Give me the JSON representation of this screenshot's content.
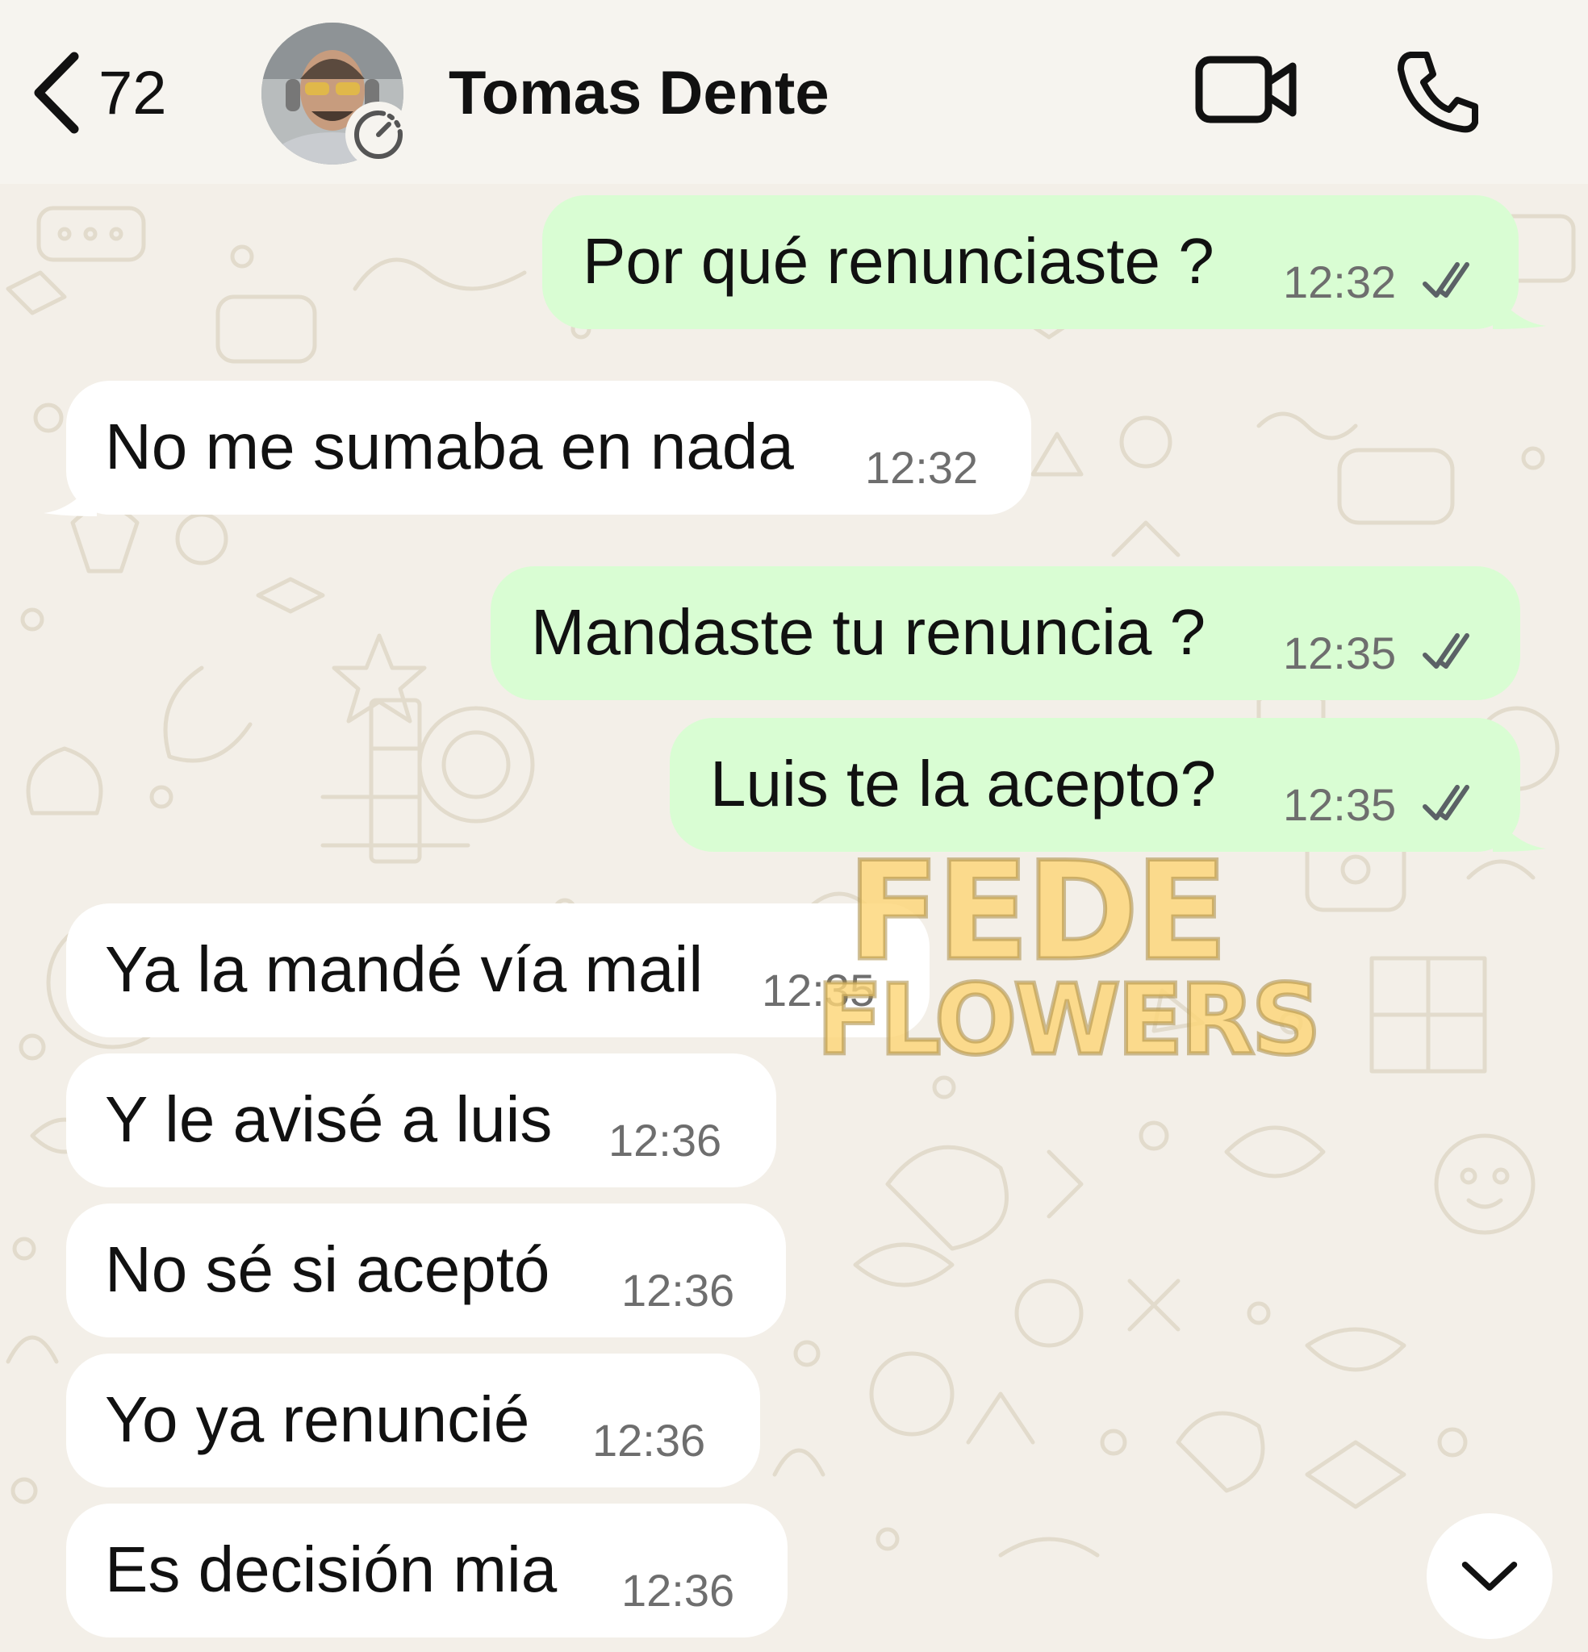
{
  "header": {
    "back_count": "72",
    "contact_name": "Tomas Dente"
  },
  "messages": [
    {
      "direction": "out",
      "text": "Por qué renunciaste ?",
      "time": "12:32",
      "read": true
    },
    {
      "direction": "in",
      "text": "No me sumaba en nada",
      "time": "12:32"
    },
    {
      "direction": "out",
      "text": "Mandaste tu renuncia ?",
      "time": "12:35",
      "read": true
    },
    {
      "direction": "out",
      "text": "Luis te la acepto?",
      "time": "12:35",
      "read": true
    },
    {
      "direction": "in",
      "text": "Ya la mandé vía mail",
      "time": "12:35"
    },
    {
      "direction": "in",
      "text": "Y le avisé a luis",
      "time": "12:36"
    },
    {
      "direction": "in",
      "text": "No sé si aceptó",
      "time": "12:36"
    },
    {
      "direction": "in",
      "text": "Yo ya renuncié",
      "time": "12:36"
    },
    {
      "direction": "in",
      "text": "Es decisión mia",
      "time": "12:36"
    }
  ],
  "watermark": {
    "line1": "FEDE",
    "line2": "FLOWERS"
  },
  "colors": {
    "outgoing_bubble": "#d9fdd3",
    "incoming_bubble": "#ffffff",
    "chat_background": "#f3efe8",
    "header_background": "#f6f4ef",
    "read_ticks": "#5b6166"
  },
  "icons": {
    "back": "chevron-left-icon",
    "status": "status-ring-icon",
    "video": "video-camera-icon",
    "call": "phone-icon",
    "ticks": "double-check-icon",
    "scroll": "chevron-down-icon"
  }
}
